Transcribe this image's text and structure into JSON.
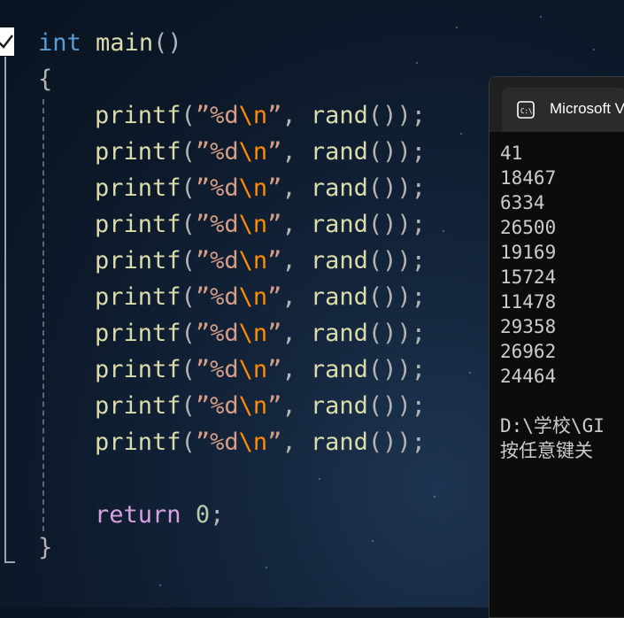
{
  "editor": {
    "signature": {
      "type": "int",
      "name": "main",
      "parens": "()"
    },
    "open_brace": "{",
    "close_brace": "}",
    "printf_lines": [
      {
        "fn": "printf",
        "open": "(",
        "q1": "”",
        "fmt": "%d",
        "esc": "\\n",
        "q2": "”",
        "sep": ", ",
        "call": "rand",
        "call_parens": "()",
        "close": ");"
      },
      {
        "fn": "printf",
        "open": "(",
        "q1": "”",
        "fmt": "%d",
        "esc": "\\n",
        "q2": "”",
        "sep": ", ",
        "call": "rand",
        "call_parens": "()",
        "close": ");"
      },
      {
        "fn": "printf",
        "open": "(",
        "q1": "”",
        "fmt": "%d",
        "esc": "\\n",
        "q2": "”",
        "sep": ", ",
        "call": "rand",
        "call_parens": "()",
        "close": ");"
      },
      {
        "fn": "printf",
        "open": "(",
        "q1": "”",
        "fmt": "%d",
        "esc": "\\n",
        "q2": "”",
        "sep": ", ",
        "call": "rand",
        "call_parens": "()",
        "close": ");"
      },
      {
        "fn": "printf",
        "open": "(",
        "q1": "”",
        "fmt": "%d",
        "esc": "\\n",
        "q2": "”",
        "sep": ", ",
        "call": "rand",
        "call_parens": "()",
        "close": ");"
      },
      {
        "fn": "printf",
        "open": "(",
        "q1": "”",
        "fmt": "%d",
        "esc": "\\n",
        "q2": "”",
        "sep": ", ",
        "call": "rand",
        "call_parens": "()",
        "close": ");"
      },
      {
        "fn": "printf",
        "open": "(",
        "q1": "”",
        "fmt": "%d",
        "esc": "\\n",
        "q2": "”",
        "sep": ", ",
        "call": "rand",
        "call_parens": "()",
        "close": ");"
      },
      {
        "fn": "printf",
        "open": "(",
        "q1": "”",
        "fmt": "%d",
        "esc": "\\n",
        "q2": "”",
        "sep": ", ",
        "call": "rand",
        "call_parens": "()",
        "close": ");"
      },
      {
        "fn": "printf",
        "open": "(",
        "q1": "”",
        "fmt": "%d",
        "esc": "\\n",
        "q2": "”",
        "sep": ", ",
        "call": "rand",
        "call_parens": "()",
        "close": ");"
      },
      {
        "fn": "printf",
        "open": "(",
        "q1": "”",
        "fmt": "%d",
        "esc": "\\n",
        "q2": "”",
        "sep": ", ",
        "call": "rand",
        "call_parens": "()",
        "close": ");"
      }
    ],
    "return_line": {
      "kw": "return",
      "value": "0",
      "end": ";"
    }
  },
  "terminal": {
    "tab_title": "Microsoft V",
    "output": [
      "41",
      "18467",
      "6334",
      "26500",
      "19169",
      "15724",
      "11478",
      "29358",
      "26962",
      "24464"
    ],
    "path_line": "D:\\学校\\GI",
    "prompt_line": "按任意键关"
  },
  "colors": {
    "keyword_type": "#569cd6",
    "function": "#dcdcaa",
    "string": "#d69d85",
    "escape": "#ff8c00",
    "keyword_return": "#d8a0df",
    "number": "#b5cea8"
  },
  "icons": [
    "checkbox-icon",
    "terminal-app-icon"
  ]
}
